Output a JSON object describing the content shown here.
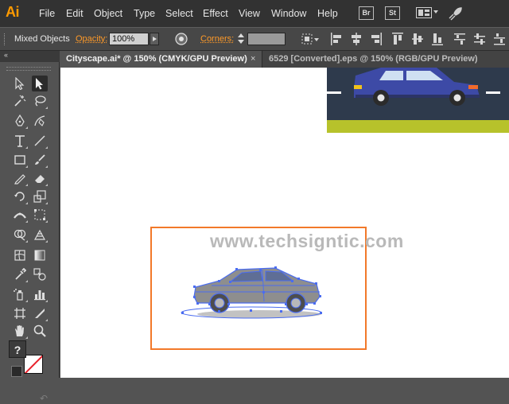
{
  "app": {
    "logo": "Ai"
  },
  "menu": {
    "items": [
      "File",
      "Edit",
      "Object",
      "Type",
      "Select",
      "Effect",
      "View",
      "Window",
      "Help"
    ],
    "bridge_badge": "Br",
    "stock_badge": "St"
  },
  "control_bar": {
    "selection_label": "Mixed Objects",
    "opacity_label": "Opacity:",
    "opacity_value": "100%",
    "corners_label": "Corners:",
    "corners_value": ""
  },
  "tabs": [
    {
      "label": "Cityscape.ai* @ 150% (CMYK/GPU Preview)",
      "close": "×",
      "active": true
    },
    {
      "label": "6529 [Converted].eps @ 150% (RGB/GPU Preview)",
      "close": "",
      "active": false
    }
  ],
  "tools_panel": {
    "collapse_label": "‹‹",
    "default_colors_label": "?",
    "swap_label": "↶"
  },
  "canvas": {
    "watermark": "www.techsigntic.com"
  },
  "colors": {
    "app_accent": "#ff9a00",
    "selection_box": "#f2792a",
    "path_selection": "#4a6cf0",
    "car_body_thumb": "#3d4aa6",
    "road_thumb": "#2e3a4c",
    "grass_thumb": "#b7c22b"
  }
}
